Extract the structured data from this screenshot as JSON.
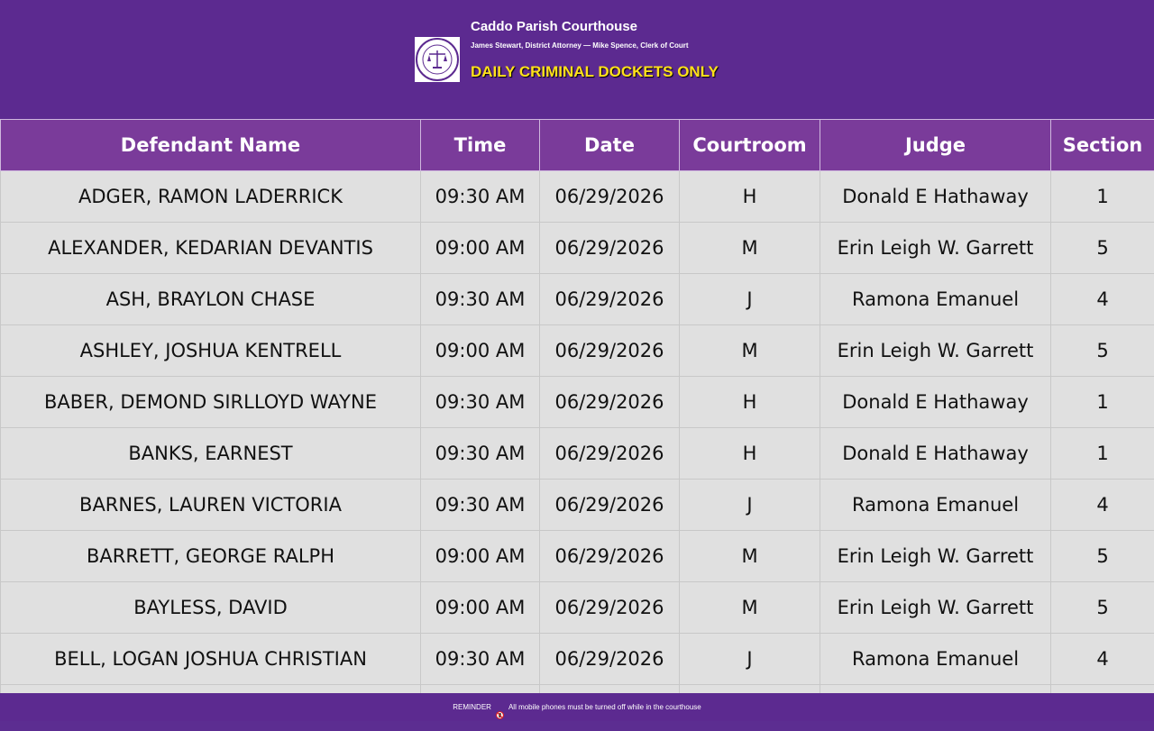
{
  "header": {
    "title": "Caddo Parish Courthouse",
    "subtitle": "James Stewart, District Attorney — Mike Spence, Clerk of Court",
    "banner": "DAILY CRIMINAL DOCKETS ONLY",
    "seal_icon": "parish-seal-icon",
    "colors": {
      "background": "#5c2a90",
      "banner_text": "#ffe11a"
    }
  },
  "table": {
    "columns": [
      "Defendant Name",
      "Time",
      "Date",
      "Courtroom",
      "Judge",
      "Section"
    ],
    "rows": [
      [
        "ADGER, RAMON LADERRICK",
        "09:30 AM",
        "06/29/2026",
        "H",
        "Donald E Hathaway",
        "1"
      ],
      [
        "ALEXANDER, KEDARIAN DEVANTIS",
        "09:00 AM",
        "06/29/2026",
        "M",
        "Erin Leigh W. Garrett",
        "5"
      ],
      [
        "ASH, BRAYLON CHASE",
        "09:30 AM",
        "06/29/2026",
        "J",
        "Ramona Emanuel",
        "4"
      ],
      [
        "ASHLEY, JOSHUA KENTRELL",
        "09:00 AM",
        "06/29/2026",
        "M",
        "Erin Leigh W. Garrett",
        "5"
      ],
      [
        "BABER, DEMOND SIRLLOYD WAYNE",
        "09:30 AM",
        "06/29/2026",
        "H",
        "Donald E Hathaway",
        "1"
      ],
      [
        "BANKS, EARNEST",
        "09:30 AM",
        "06/29/2026",
        "H",
        "Donald E Hathaway",
        "1"
      ],
      [
        "BARNES, LAUREN VICTORIA",
        "09:30 AM",
        "06/29/2026",
        "J",
        "Ramona Emanuel",
        "4"
      ],
      [
        "BARRETT, GEORGE RALPH",
        "09:00 AM",
        "06/29/2026",
        "M",
        "Erin Leigh W. Garrett",
        "5"
      ],
      [
        "BAYLESS, DAVID",
        "09:00 AM",
        "06/29/2026",
        "M",
        "Erin Leigh W. Garrett",
        "5"
      ],
      [
        "BELL, LOGAN JOSHUA CHRISTIAN",
        "09:30 AM",
        "06/29/2026",
        "J",
        "Ramona Emanuel",
        "4"
      ],
      [
        "",
        "",
        "",
        "",
        "",
        ""
      ]
    ],
    "colors": {
      "header_bg": "#7a3b9a",
      "row_bg": "#e0e0e0"
    }
  },
  "footer": {
    "label": "REMINDER",
    "icon": "no-phone-icon",
    "message": "All mobile phones must be turned off while in the courthouse"
  }
}
